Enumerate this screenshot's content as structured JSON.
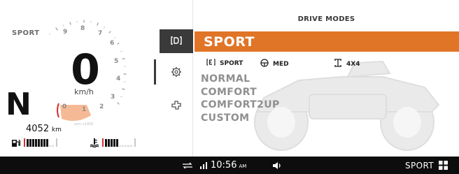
{
  "cluster": {
    "mode_small": "SPORT",
    "gauge_numbers": [
      "9",
      "8",
      "7",
      "6",
      "5",
      "4",
      "3",
      "2",
      "1",
      "0"
    ],
    "speed": "0",
    "speed_unit": "km/h",
    "gear": "N",
    "rpm_label": "rpm x1000",
    "odometer_value": "4052",
    "odometer_unit": "km",
    "fuel_level_segments": 8,
    "fuel_total_segments": 10,
    "temp_level_segments": 5,
    "temp_total_segments": 10
  },
  "sidenav": {
    "items": [
      {
        "name": "drive-mode-tab",
        "icon": "drive-mode-icon",
        "active": true
      },
      {
        "name": "settings-tab",
        "icon": "gear-icon",
        "active": false
      },
      {
        "name": "vehicle-tab",
        "icon": "puzzle-icon",
        "active": false
      }
    ]
  },
  "panel": {
    "title": "DRIVE MODES",
    "selected_mode": "SPORT",
    "sub_settings": [
      {
        "icon": "engine-mode-icon",
        "label": "SPORT"
      },
      {
        "icon": "steering-icon",
        "label": "MED"
      },
      {
        "icon": "drivetrain-icon",
        "label": "4X4"
      }
    ],
    "modes": [
      "NORMAL",
      "COMFORT",
      "COMFORT2UP",
      "CUSTOM"
    ]
  },
  "statusbar": {
    "time": "10:56",
    "ampm": "AM",
    "mode": "SPORT",
    "icons": [
      "connection-icon",
      "signal-icon",
      "volume-icon",
      "grid-menu-icon"
    ]
  },
  "colors": {
    "accent": "#e07427",
    "statusbar_bg": "#0d0d0d",
    "nav_active": "#3a3a3a",
    "gauge_red": "#d3302f"
  }
}
